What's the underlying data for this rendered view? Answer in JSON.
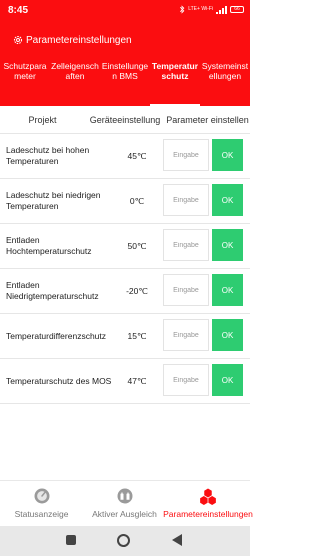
{
  "status_bar": {
    "time": "8:45",
    "network_text": "LTE+ Wi-Fi",
    "battery_level": "66",
    "icons": [
      "bluetooth-icon",
      "signal-icon",
      "battery-icon"
    ]
  },
  "header": {
    "title": "Parametereinstellungen",
    "icon": "gear-icon"
  },
  "tabs": [
    {
      "label": "Schutzparameter",
      "active": false
    },
    {
      "label": "Zelleigenschaften",
      "active": false
    },
    {
      "label": "Einstellungen BMS",
      "active": false
    },
    {
      "label": "Temperaturschutz",
      "active": true
    },
    {
      "label": "Systemeinstellungen",
      "active": false
    }
  ],
  "table": {
    "headers": [
      "Projekt",
      "Geräteeinstellung",
      "Parameter einstellen"
    ],
    "rows": [
      {
        "name": "Ladeschutz bei hohen Temperaturen",
        "value": "45℃",
        "placeholder": "Eingabe",
        "ok": "OK"
      },
      {
        "name": "Ladeschutz bei niedrigen Temperaturen",
        "value": "0℃",
        "placeholder": "Eingabe",
        "ok": "OK"
      },
      {
        "name": "Entladen Hochtemperaturschutz",
        "value": "50℃",
        "placeholder": "Eingabe",
        "ok": "OK"
      },
      {
        "name": "Entladen Niedrigtemperaturschutz",
        "value": "-20℃",
        "placeholder": "Eingabe",
        "ok": "OK"
      },
      {
        "name": "Temperaturdifferenzschutz",
        "value": "15℃",
        "placeholder": "Eingabe",
        "ok": "OK"
      },
      {
        "name": "Temperaturschutz des MOS",
        "value": "47℃",
        "placeholder": "Eingabe",
        "ok": "OK"
      }
    ]
  },
  "bottom_nav": [
    {
      "label": "Statusanzeige",
      "icon": "status-gauge-icon",
      "active": false
    },
    {
      "label": "Aktiver Ausgleich",
      "icon": "balance-battery-icon",
      "active": false
    },
    {
      "label": "Parametereinstellungen",
      "icon": "parameter-cubes-icon",
      "active": true
    }
  ],
  "colors": {
    "brand_red": "#fb0d10",
    "ok_green": "#2ecc71",
    "nav_inactive": "#777777"
  }
}
